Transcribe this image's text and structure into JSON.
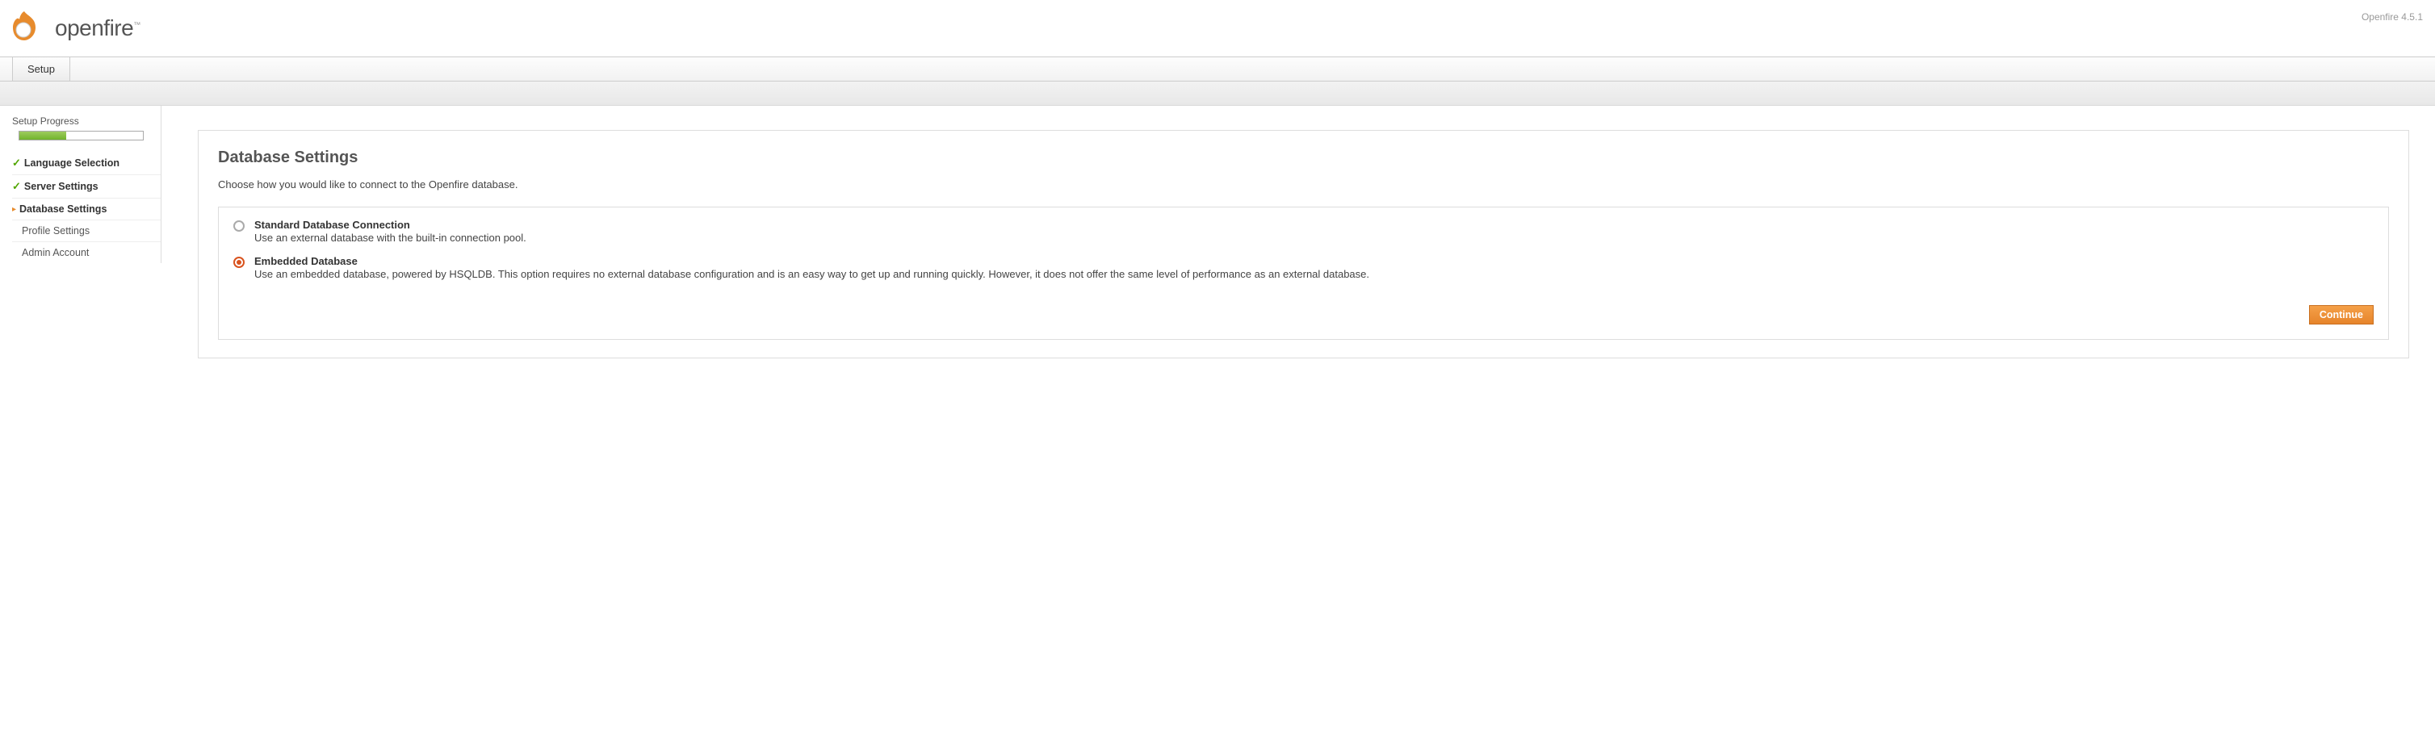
{
  "header": {
    "brand": "openfire",
    "tm": "™",
    "version": "Openfire 4.5.1"
  },
  "tab": {
    "setup": "Setup"
  },
  "sidebar": {
    "progress_label": "Setup Progress",
    "steps": [
      {
        "label": "Language Selection",
        "state": "done"
      },
      {
        "label": "Server Settings",
        "state": "done"
      },
      {
        "label": "Database Settings",
        "state": "current"
      },
      {
        "label": "Profile Settings",
        "state": "pending"
      },
      {
        "label": "Admin Account",
        "state": "pending"
      }
    ]
  },
  "page": {
    "title": "Database Settings",
    "subtitle": "Choose how you would like to connect to the Openfire database.",
    "options": [
      {
        "title": "Standard Database Connection",
        "desc": "Use an external database with the built-in connection pool.",
        "selected": false
      },
      {
        "title": "Embedded Database",
        "desc": "Use an embedded database, powered by HSQLDB. This option requires no external database configuration and is an easy way to get up and running quickly. However, it does not offer the same level of performance as an external database.",
        "selected": true
      }
    ],
    "continue": "Continue"
  }
}
